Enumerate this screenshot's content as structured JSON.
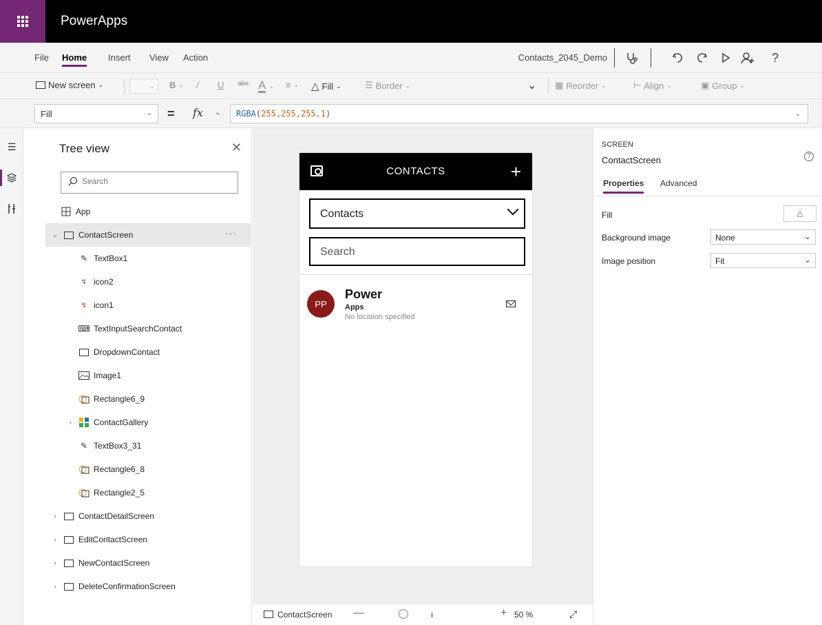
{
  "app": {
    "title": "PowerApps"
  },
  "menu": {
    "items": [
      "File",
      "Home",
      "Insert",
      "View",
      "Action"
    ],
    "filename": "Contacts_2045_Demo"
  },
  "toolbar": {
    "new_screen": "New screen",
    "fill": "Fill",
    "border": "Border",
    "reorder": "Reorder",
    "align": "Align",
    "group": "Group"
  },
  "formula": {
    "property": "Fill",
    "eq": "=",
    "fx": "fx",
    "fn": "RGBA",
    "args": "255,255,255,1"
  },
  "tree": {
    "title": "Tree view",
    "search_placeholder": "Search",
    "app": "App",
    "screen": "ContactScreen",
    "children": [
      "TextBox1",
      "icon2",
      "icon1",
      "TextInputSearchContact",
      "DropdownContact",
      "Image1",
      "Rectangle6_9",
      "ContactGallery",
      "TextBox3_31",
      "Rectangle6_8",
      "Rectangle2_5"
    ],
    "other_screens": [
      "ContactDetailScreen",
      "EditContactScreen",
      "NewContactScreen",
      "DeleteConfirmationScreen"
    ]
  },
  "phone": {
    "header_title": "CONTACTS",
    "plus": "+",
    "dropdown_value": "Contacts",
    "search_placeholder": "Search",
    "avatar_initials": "PP",
    "contact_name": "Power",
    "contact_sub": "Apps",
    "contact_location": "No location specified"
  },
  "statusbar": {
    "screen_name": "ContactScreen",
    "zoom": "50 %"
  },
  "props": {
    "type": "SCREEN",
    "name": "ContactScreen",
    "tab_properties": "Properties",
    "tab_advanced": "Advanced",
    "fill_label": "Fill",
    "bg_label": "Background image",
    "bg_value": "None",
    "pos_label": "Image position",
    "pos_value": "Fit"
  },
  "colors": {
    "accent": "#742774",
    "avatar": "#8b1a1a"
  }
}
